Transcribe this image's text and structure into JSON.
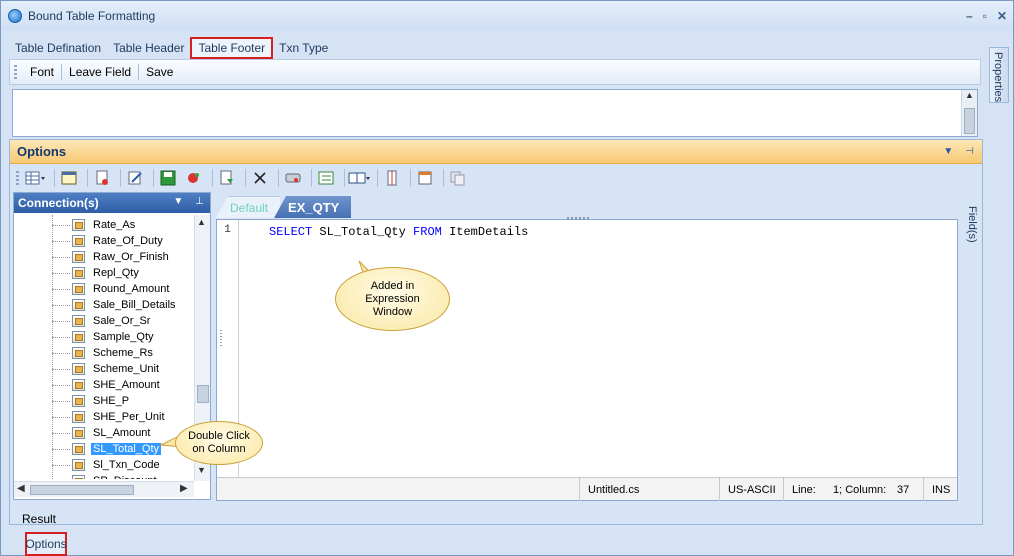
{
  "window": {
    "title": "Bound Table Formatting",
    "controls": [
      "–",
      "▫",
      "✕"
    ]
  },
  "tabs": [
    {
      "label": "Table Defination",
      "active": false
    },
    {
      "label": "Table Header",
      "active": false
    },
    {
      "label": "Table Footer",
      "active": true
    },
    {
      "label": "Txn Type",
      "active": false
    }
  ],
  "toolbar1": {
    "font": "Font",
    "leave_field": "Leave Field",
    "save": "Save"
  },
  "properties_label": "Properties",
  "options": {
    "title": "Options",
    "icon_toolbar": [
      "grid-dropdown-icon",
      "table-icon",
      "delete-doc-icon",
      "edit-doc-icon",
      "save-icon",
      "run-icon",
      "export-doc-icon",
      "close-x-icon",
      "disk-icon",
      "list-icon",
      "book-dropdown-icon",
      "columns-icon",
      "calendar-icon",
      "copy-icon"
    ]
  },
  "connections": {
    "title": "Connection(s)",
    "items": [
      "Rate_As",
      "Rate_Of_Duty",
      "Raw_Or_Finish",
      "Repl_Qty",
      "Round_Amount",
      "Sale_Bill_Details",
      "Sale_Or_Sr",
      "Sample_Qty",
      "Scheme_Rs",
      "Scheme_Unit",
      "SHE_Amount",
      "SHE_P",
      "SHE_Per_Unit",
      "SL_Amount",
      "SL_Total_Qty",
      "Sl_Txn_Code",
      "SP_Discount"
    ],
    "selected": "SL_Total_Qty"
  },
  "editor": {
    "tabs": [
      {
        "label": "Default",
        "active": false
      },
      {
        "label": "EX_QTY",
        "active": true
      }
    ],
    "line_number": "1",
    "code": {
      "kw1": "SELECT",
      "ident1": "SL_Total_Qty",
      "kw2": "FROM",
      "ident2": "ItemDetails"
    },
    "status": {
      "file": "Untitled.cs",
      "encoding": "US-ASCII",
      "line_label": "Line:",
      "line_value": "1; Column:",
      "column_value": "37",
      "mode": "INS"
    }
  },
  "fields_label": "Field(s)",
  "result_label": "Result",
  "bottom_tab": "Options",
  "callouts": {
    "expression": "Added in Expression Window",
    "double_click": "Double Click on Column"
  },
  "colors": {
    "options_header": "#f7c873",
    "connections_header": "#2f5da5",
    "highlight": "#d62020",
    "selection": "#3399ff",
    "keyword": "#0000ff"
  }
}
